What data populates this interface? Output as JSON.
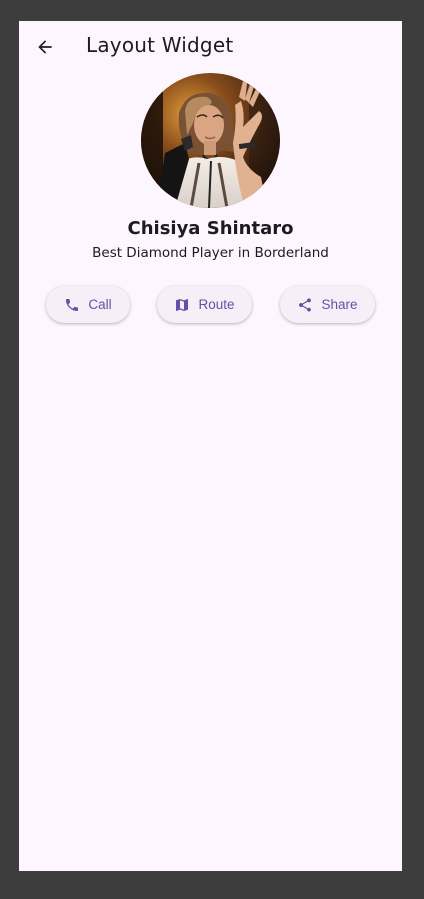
{
  "appbar": {
    "back_icon": "arrow-back-icon",
    "title": "Layout Widget"
  },
  "profile": {
    "avatar_icon": "profile-photo",
    "name": "Chisiya Shintaro",
    "subtitle": "Best Diamond Player in Borderland"
  },
  "actions": [
    {
      "icon": "phone-icon",
      "label": "Call"
    },
    {
      "icon": "map-icon",
      "label": "Route"
    },
    {
      "icon": "share-icon",
      "label": "Share"
    }
  ],
  "colors": {
    "background": "#fdf6fe",
    "frame": "#3d3d3d",
    "accent": "#6750a4",
    "button_bg": "#f6eff8",
    "text": "#1d1b20"
  }
}
